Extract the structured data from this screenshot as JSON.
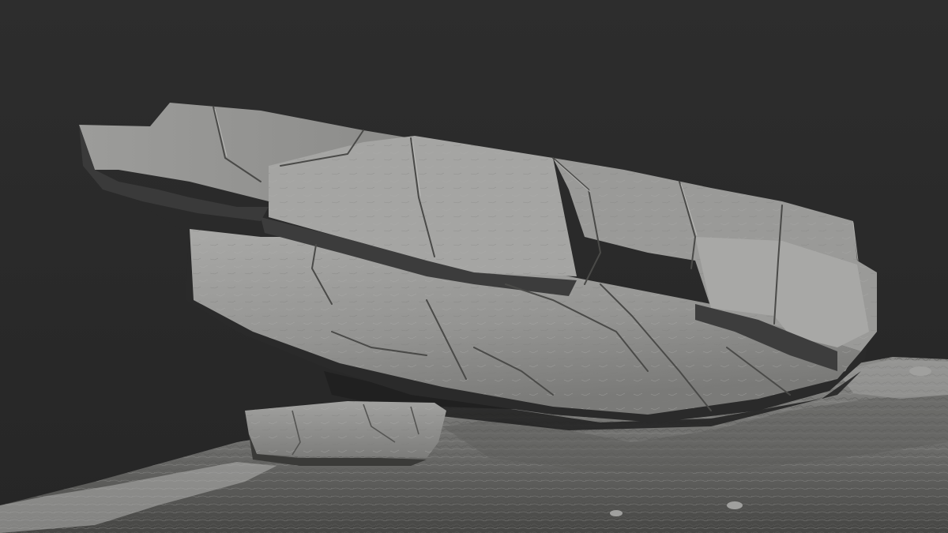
{
  "scene": {
    "subject": "sculpted-rock-formation",
    "colors": {
      "background": "#2b2b2b",
      "rock_light": "#a3a3a1",
      "rock_mid": "#8f8f8d",
      "rock_dark": "#5e5e5c",
      "shadow": "#1e1e1e",
      "ground_light": "#8d8d8b",
      "ground_dark": "#4f4f4d"
    }
  }
}
